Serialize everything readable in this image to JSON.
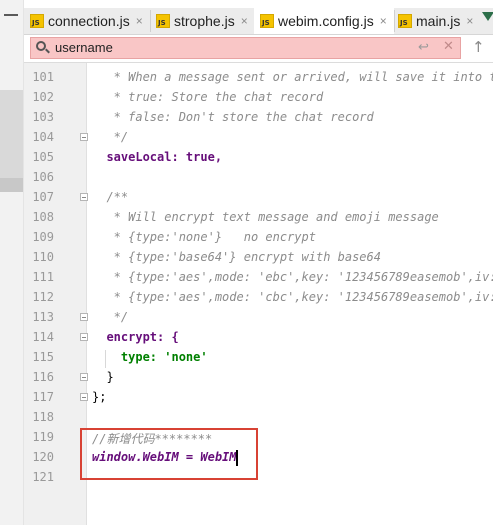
{
  "tabs": [
    {
      "icon": "js-file-icon",
      "icon_text": "JS",
      "label": "connection.js",
      "close": "×",
      "active": false
    },
    {
      "icon": "js-file-icon",
      "icon_text": "JS",
      "label": "strophe.js",
      "close": "×",
      "active": false
    },
    {
      "icon": "js-file-icon",
      "icon_text": "JS",
      "label": "webim.config.js",
      "close": "×",
      "active": true
    },
    {
      "icon": "js-file-icon",
      "icon_text": "JS",
      "label": "main.js",
      "close": "×",
      "active": false
    }
  ],
  "search": {
    "value": "username",
    "enter_glyph": "↩",
    "clear_glyph": "✕",
    "up_glyph": "↑"
  },
  "editor": {
    "lines": [
      {
        "n": "101",
        "text": "   * When a message sent or arrived, will save it into the"
      },
      {
        "n": "102",
        "text": "   * true: Store the chat record"
      },
      {
        "n": "103",
        "text": "   * false: Don't store the chat record"
      },
      {
        "n": "104",
        "text": "   */"
      },
      {
        "n": "105",
        "text": "  saveLocal: true,"
      },
      {
        "n": "106",
        "text": ""
      },
      {
        "n": "107",
        "text": "  /**"
      },
      {
        "n": "108",
        "text": "   * Will encrypt text message and emoji message"
      },
      {
        "n": "109",
        "text": "   * {type:'none'}   no encrypt"
      },
      {
        "n": "110",
        "text": "   * {type:'base64'} encrypt with base64"
      },
      {
        "n": "111",
        "text": "   * {type:'aes',mode: 'ebc',key: '123456789easemob',iv:"
      },
      {
        "n": "112",
        "text": "   * {type:'aes',mode: 'cbc',key: '123456789easemob',iv:"
      },
      {
        "n": "113",
        "text": "   */"
      },
      {
        "n": "114",
        "text": "  encrypt: {"
      },
      {
        "n": "115",
        "text": "    type: 'none'"
      },
      {
        "n": "116",
        "text": "  }"
      },
      {
        "n": "117",
        "text": "};"
      },
      {
        "n": "118",
        "text": ""
      },
      {
        "n": "119",
        "text": "//新增代码********"
      },
      {
        "n": "120",
        "text": "window.WebIM = WebIM"
      },
      {
        "n": "121",
        "text": ""
      }
    ]
  },
  "colors": {
    "search_bg": "#f9c6c6",
    "highlight_border": "#d84234",
    "js_icon": "#f5c300",
    "keyword": "#000080",
    "property": "#660e7a",
    "string": "#008000",
    "comment": "#8c8c8c"
  }
}
